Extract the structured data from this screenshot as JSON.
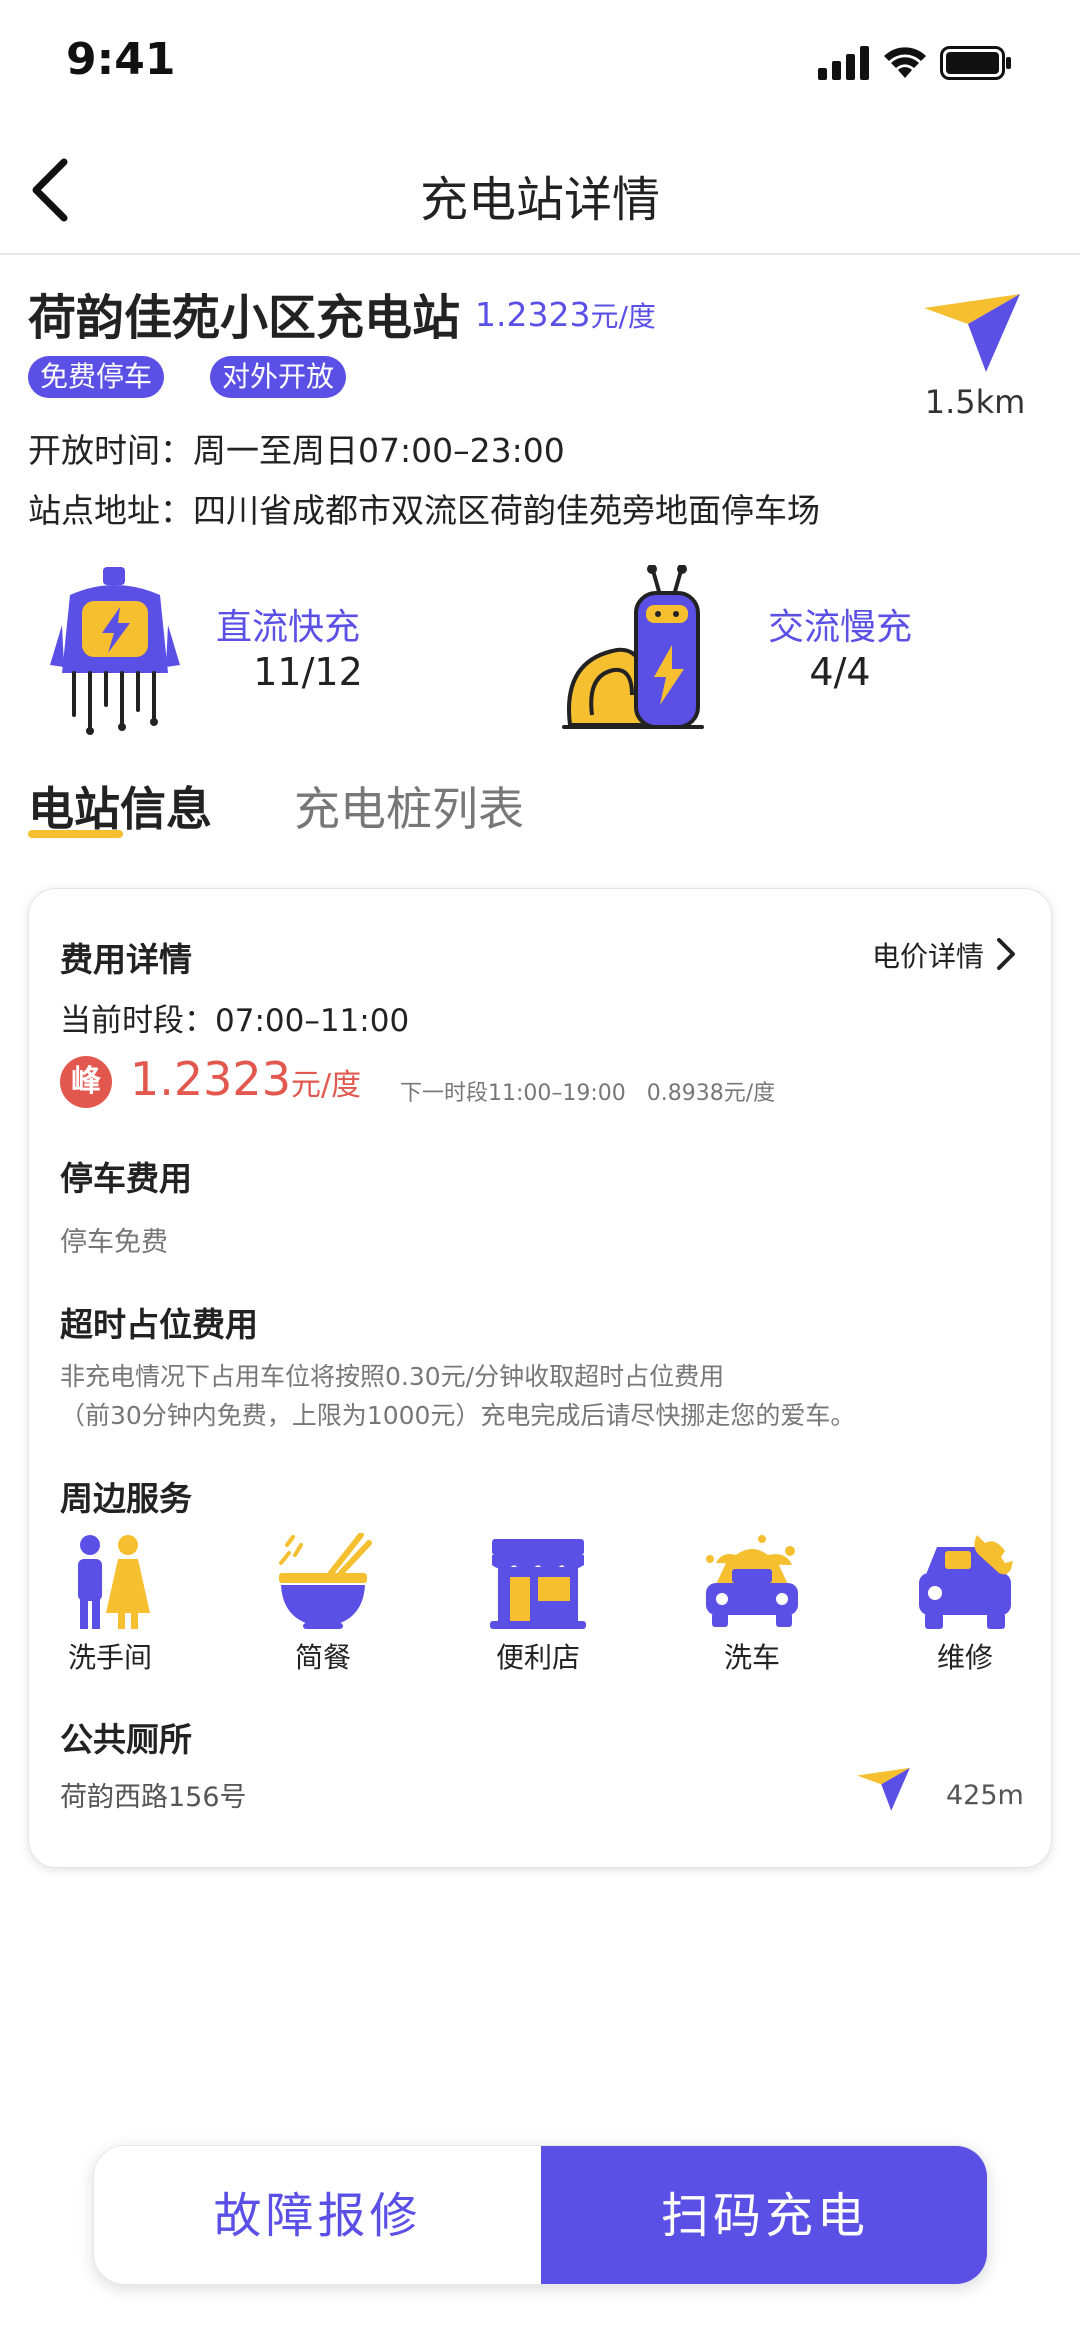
{
  "status_bar": {
    "time": "9:41"
  },
  "nav": {
    "title": "充电站详情"
  },
  "station": {
    "name": "荷韵佳苑小区充电站",
    "price_value": "1.2323",
    "price_unit": "元/度",
    "tags": [
      "免费停车",
      "对外开放"
    ],
    "distance": "1.5km",
    "hours": "开放时间：周一至周日07:00–23:00",
    "address": "站点地址：四川省成都市双流区荷韵佳苑旁地面停车场"
  },
  "charge_types": {
    "dc": {
      "label": "直流快充",
      "value": "11/12"
    },
    "ac": {
      "label": "交流慢充",
      "value": "4/4"
    }
  },
  "tabs": {
    "active": "电站信息",
    "inactive": "充电桩列表"
  },
  "fee": {
    "heading": "费用详情",
    "detail_link": "电价详情",
    "current_period": "当前时段：07:00–11:00",
    "peak_badge": "峰",
    "peak_price": "1.2323",
    "peak_unit": "元/度",
    "next_period": "下一时段11:00–19:00   0.8938元/度"
  },
  "parking": {
    "heading": "停车费用",
    "text": "停车免费"
  },
  "overtime": {
    "heading": "超时占位费用",
    "line1": "非充电情况下占用车位将按照0.30元/分钟收取超时占位费用",
    "line2": "（前30分钟内免费，上限为1000元）充电完成后请尽快挪走您的爱车。"
  },
  "services": {
    "heading": "周边服务",
    "items": [
      "洗手间",
      "简餐",
      "便利店",
      "洗车",
      "维修"
    ]
  },
  "toilet": {
    "heading": "公共厕所",
    "address": "荷韵西路156号",
    "distance": "425m"
  },
  "buttons": {
    "repair": "故障报修",
    "scan": "扫码充电"
  },
  "colors": {
    "accent": "#5b50e6",
    "yellow": "#f5bf30",
    "peak_red": "#e2584f"
  }
}
